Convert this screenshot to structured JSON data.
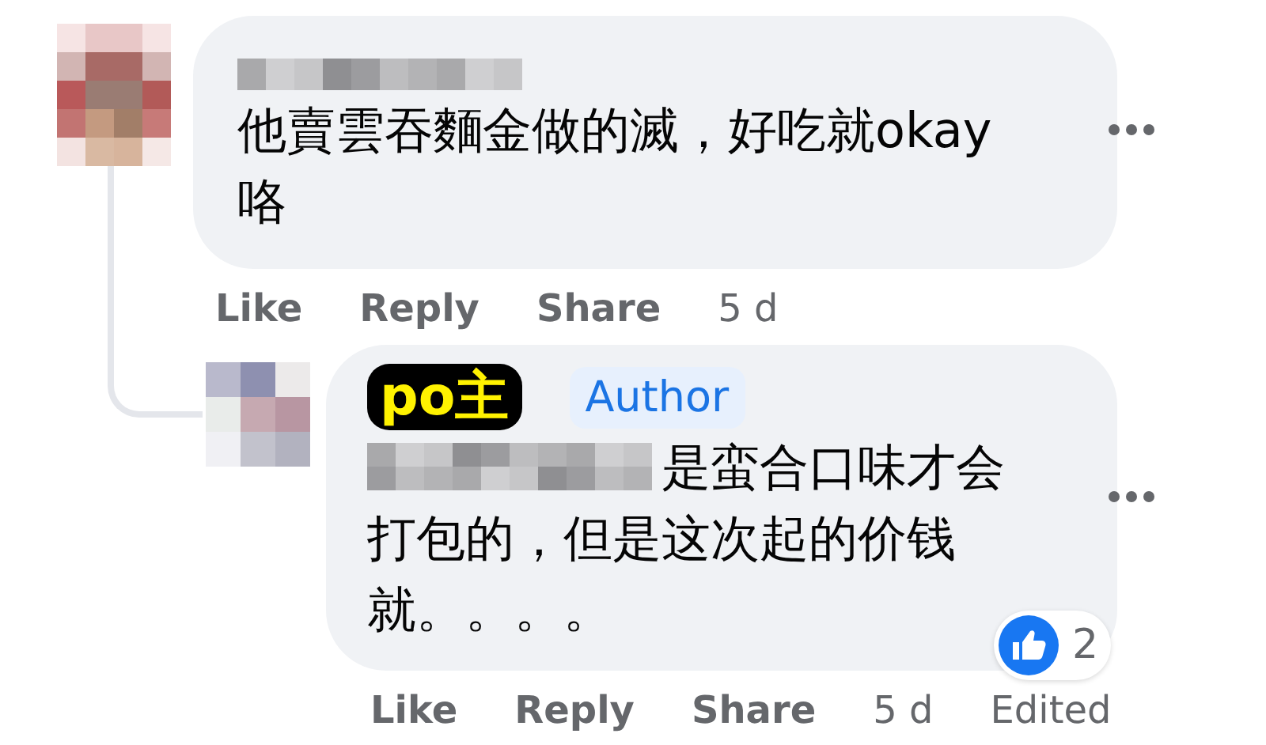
{
  "comments": [
    {
      "text": "他賣雲吞麵金做的滅，好吃就okay咯",
      "actions": [
        "Like",
        "Reply",
        "Share"
      ],
      "time": "5 d"
    },
    {
      "sticker": "po主",
      "badge": "Author",
      "text": "是蛮合口味才会打包的，但是这次起的价钱就。。。。",
      "actions": [
        "Like",
        "Reply",
        "Share"
      ],
      "time": "5 d",
      "edited": "Edited",
      "reactions": "2"
    }
  ]
}
